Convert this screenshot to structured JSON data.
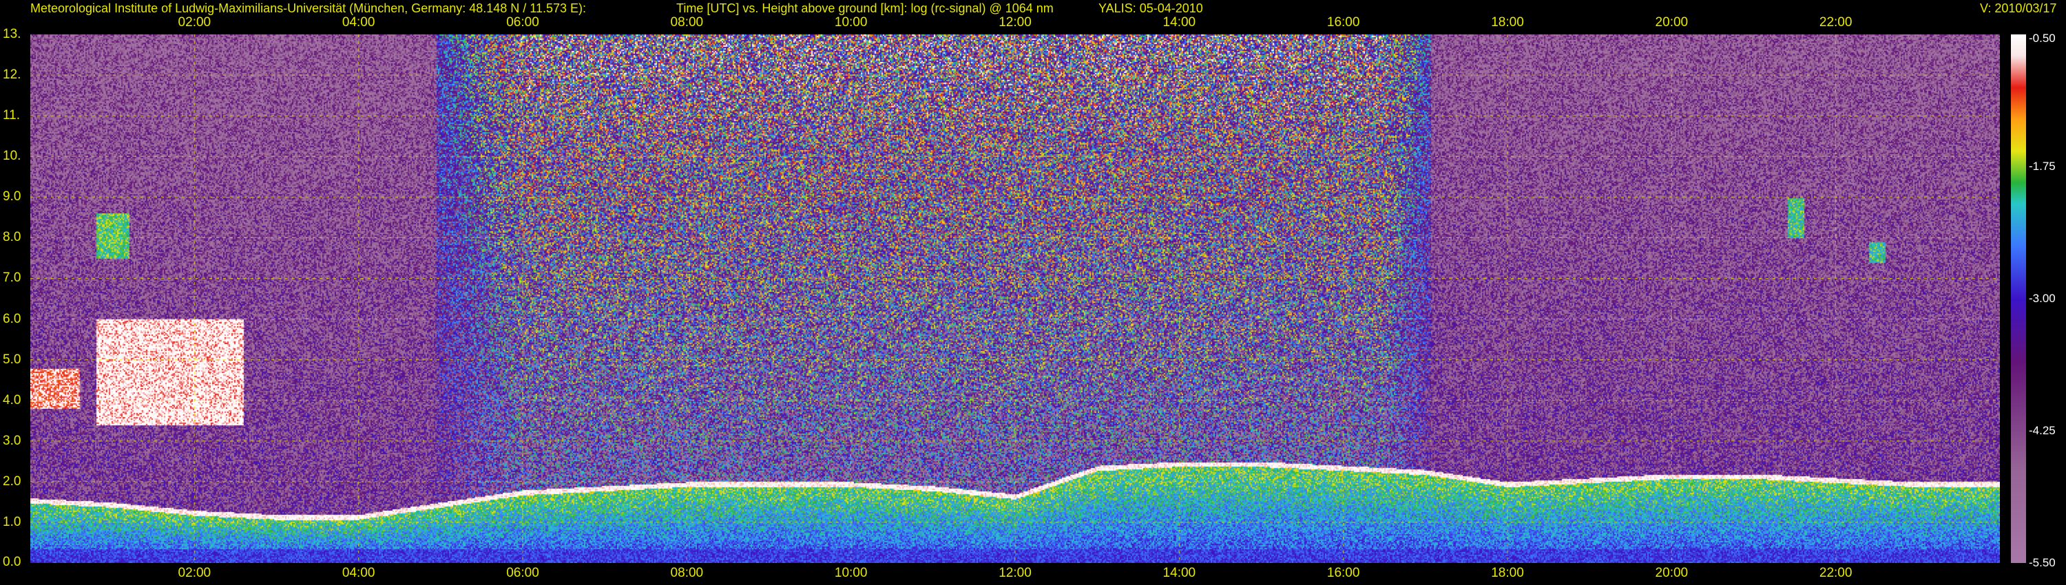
{
  "header": {
    "institute": "Meteorological Institute of Ludwig-Maximilians-Universität (München, Germany: 48.148 N / 11.573 E):",
    "axes_desc": "Time [UTC] vs. Height above ground [km]: log (rc-signal) @ 1064 nm",
    "instrument": "YALIS: 05-04-2010",
    "version": "V: 2010/03/17"
  },
  "chart_data": {
    "type": "heatmap",
    "title": "Time [UTC] vs. Height above ground [km]: log (rc-signal) @ 1064 nm",
    "xlabel": "Time [UTC]",
    "ylabel": "Height above ground [km]",
    "xlim": [
      0,
      24
    ],
    "ylim": [
      0,
      13
    ],
    "grid": true,
    "x_ticks": [
      "02:00",
      "04:00",
      "06:00",
      "08:00",
      "10:00",
      "12:00",
      "14:00",
      "16:00",
      "18:00",
      "20:00",
      "22:00"
    ],
    "x_tick_values": [
      2,
      4,
      6,
      8,
      10,
      12,
      14,
      16,
      18,
      20,
      22
    ],
    "y_ticks": [
      "0.0",
      "1.0",
      "2.0",
      "3.0",
      "4.0",
      "5.0",
      "6.0",
      "7.0",
      "8.0",
      "9.0",
      "10.",
      "11.",
      "12.",
      "13."
    ],
    "y_tick_values": [
      0,
      1,
      2,
      3,
      4,
      5,
      6,
      7,
      8,
      9,
      10,
      11,
      12,
      13
    ],
    "colorbar": {
      "ticks": [
        "-0.50",
        "-1.75",
        "-3.00",
        "-4.25",
        "-5.50"
      ],
      "tick_values": [
        -0.5,
        -1.75,
        -3.0,
        -4.25,
        -5.5
      ],
      "range": [
        -5.5,
        -0.5
      ]
    },
    "boundary_layer_top_km": [
      [
        0.0,
        1.6
      ],
      [
        1.0,
        1.5
      ],
      [
        2.0,
        1.3
      ],
      [
        3.0,
        1.2
      ],
      [
        4.0,
        1.2
      ],
      [
        5.0,
        1.5
      ],
      [
        6.0,
        1.8
      ],
      [
        7.0,
        1.9
      ],
      [
        8.0,
        2.0
      ],
      [
        9.0,
        2.0
      ],
      [
        10.0,
        2.0
      ],
      [
        11.0,
        1.9
      ],
      [
        12.0,
        1.7
      ],
      [
        13.0,
        2.4
      ],
      [
        14.0,
        2.5
      ],
      [
        15.0,
        2.5
      ],
      [
        16.0,
        2.4
      ],
      [
        17.0,
        2.3
      ],
      [
        18.0,
        2.0
      ],
      [
        19.0,
        2.1
      ],
      [
        20.0,
        2.2
      ],
      [
        21.0,
        2.2
      ],
      [
        22.0,
        2.1
      ],
      [
        23.0,
        2.0
      ],
      [
        24.0,
        2.0
      ]
    ],
    "cloud_layers": [
      {
        "t_start": 0.0,
        "t_end": 0.6,
        "h_bottom": 3.8,
        "h_top": 4.8,
        "level": -0.8
      },
      {
        "t_start": 0.8,
        "t_end": 2.6,
        "h_bottom": 3.4,
        "h_top": 6.0,
        "level": -0.6
      },
      {
        "t_start": 0.8,
        "t_end": 1.2,
        "h_bottom": 7.5,
        "h_top": 8.6,
        "level": -1.9
      },
      {
        "t_start": 21.4,
        "t_end": 21.6,
        "h_bottom": 8.0,
        "h_top": 9.0,
        "level": -2.0
      },
      {
        "t_start": 22.4,
        "t_end": 22.6,
        "h_bottom": 7.4,
        "h_top": 7.9,
        "level": -2.0
      }
    ]
  }
}
